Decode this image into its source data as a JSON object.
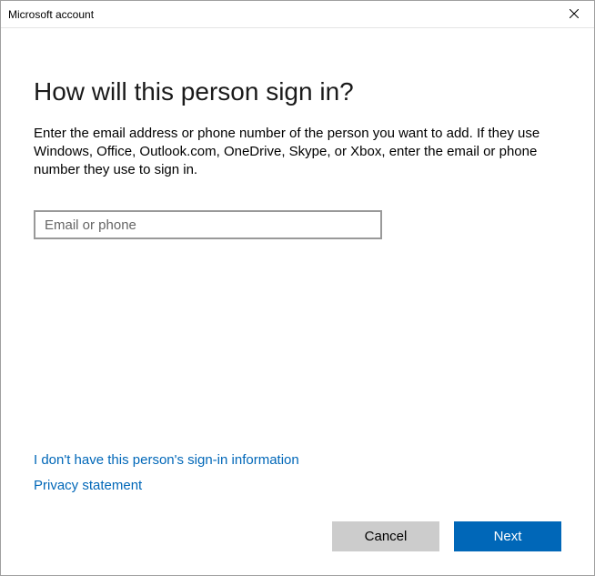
{
  "window": {
    "title": "Microsoft account"
  },
  "main": {
    "heading": "How will this person sign in?",
    "instructions": "Enter the email address or phone number of the person you want to add. If they use Windows, Office, Outlook.com, OneDrive, Skype, or Xbox, enter the email or phone number they use to sign in.",
    "input_placeholder": "Email or phone",
    "input_value": ""
  },
  "links": {
    "no_info": "I don't have this person's sign-in information",
    "privacy": "Privacy statement"
  },
  "buttons": {
    "cancel": "Cancel",
    "next": "Next"
  }
}
